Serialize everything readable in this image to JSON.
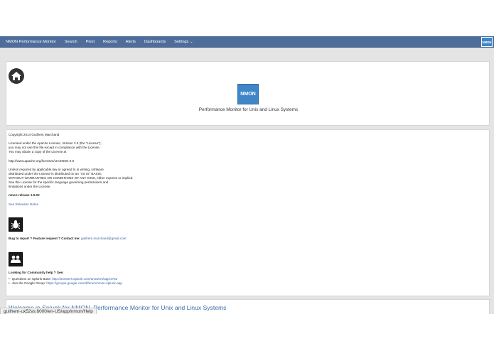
{
  "nav": {
    "brand": "NMON Performance Monitor",
    "items": [
      "Search",
      "Pivot",
      "Reports",
      "Alerts",
      "Dashboards",
      "Settings"
    ],
    "settings_caret": "⌄",
    "corner_logo": "NMON"
  },
  "header_panel": {
    "logo_text": "NMON",
    "subtitle": "Performance Monitor for Unix and Linux Systems"
  },
  "license": {
    "copyright": "Copyright 2014 Guilhem Marchand",
    "p1_l1": "Licensed under the Apache License, Version 2.0 (the \"License\");",
    "p1_l2": "you may not use this file except in compliance with the License.",
    "p1_l3": "You may obtain a copy of the License at",
    "url": "http://www.apache.org/licenses/LICENSE-2.0",
    "p2_l1": "Unless required by applicable law or agreed to in writing, software",
    "p2_l2": "distributed under the License is distributed on an \"AS IS\" BASIS,",
    "p2_l3": "WITHOUT WARRANTIES OR CONDITIONS OF ANY KIND, either express or implied.",
    "p2_l4": "See the License for the specific language governing permissions and",
    "p2_l5": "limitations under the License.",
    "release": "nmon release 1.5.02",
    "release_notes_link": "See Releases Notes"
  },
  "bug": {
    "label": "Bug to report ? Feature request ? Contact me:",
    "email": "guilhem.marchand@gmail.com"
  },
  "community": {
    "label": "Looking for Community help ? See:",
    "q_label": "Questions on Splunk Base:",
    "q_link": "http://answers.splunk.com/answers/app/1753",
    "g_label": "Join the Google Group:",
    "g_link": "https://groups.google.com/d/forum/nmon-splunk-app"
  },
  "welcome": {
    "title": "Welcome in Splunk for NMON, Performance Monitor for Unix and Linux Systems"
  },
  "status_url": "guilhem-ux52vs:8000/en-US/app/nmon/Help"
}
